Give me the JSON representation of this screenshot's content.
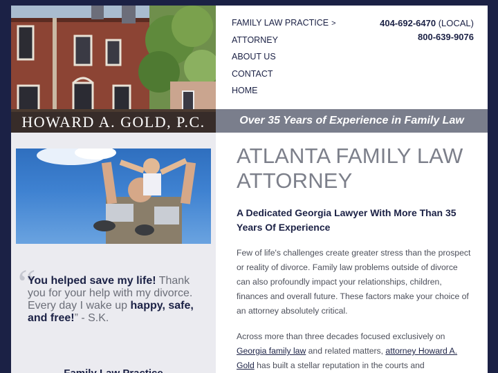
{
  "header": {
    "firm_name": "HOWARD A. GOLD, P.C.",
    "tagline": "Over 35 Years of Experience in Family Law",
    "nav": [
      {
        "label": "FAMILY LAW PRACTICE",
        "chevron": ">"
      },
      {
        "label": "ATTORNEY"
      },
      {
        "label": "ABOUT US"
      },
      {
        "label": "CONTACT"
      },
      {
        "label": "HOME"
      }
    ],
    "phones": {
      "local_number": "404-692-6470",
      "local_label": "(LOCAL)",
      "tollfree_number": "800-639-9076"
    }
  },
  "sidebar": {
    "testimonial": {
      "open_mark": "“",
      "lead_strong": "You helped save my life!",
      "text_1": " Thank you for your help with my divorce. Every day I wake up ",
      "strong_2": "happy, safe, and free!",
      "text_2": "” - S.K."
    },
    "heading": "Family Law Practice"
  },
  "main": {
    "title": "ATLANTA FAMILY LAW ATTORNEY",
    "subtitle": "A Dedicated Georgia Lawyer With More Than 35 Years Of Experience",
    "paragraph_1": "Few of life's challenges create greater stress than the prospect or reality of divorce. Family law problems outside of divorce can also profoundly impact your relationships, children, finances and overall future. These factors make your choice of an attorney absolutely critical.",
    "p2_text_1": "Across more than three decades focused exclusively on ",
    "p2_link_1": "Georgia family law",
    "p2_text_2": " and related matters, ",
    "p2_link_2": "attorney Howard A. Gold",
    "p2_text_3": " has built a stellar reputation in the courts and"
  },
  "colors": {
    "navy": "#1b2145",
    "tagline_bar": "#7a7e8c",
    "sidebar_bg": "#ebebf0",
    "title_gray": "#7c7f8a"
  }
}
